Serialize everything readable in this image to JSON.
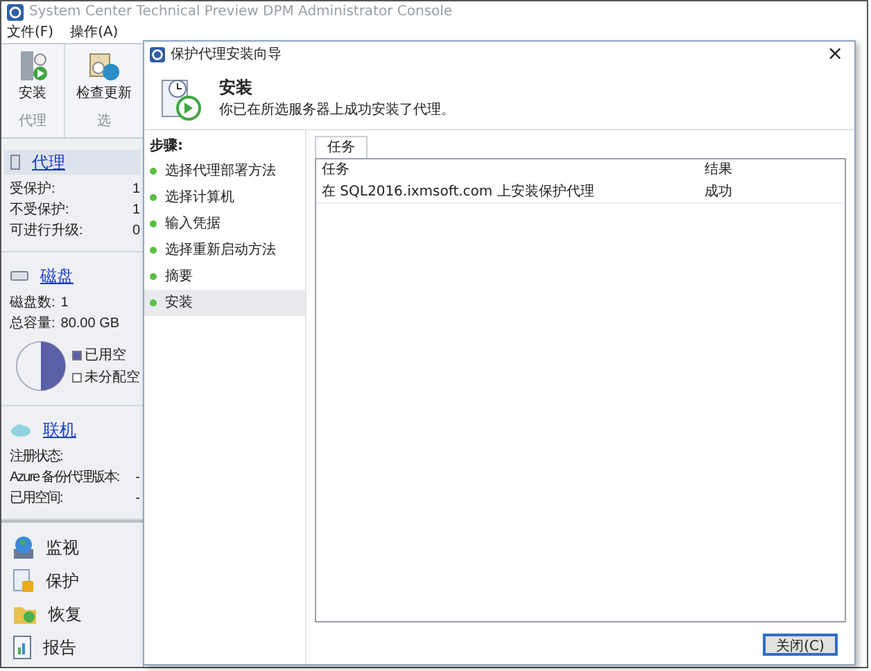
{
  "window": {
    "title": "System Center Technical Preview DPM Administrator Console"
  },
  "menu": [
    "文件(F)",
    "操作(A)"
  ],
  "ribbon": {
    "buttons": [
      {
        "label": "安装",
        "kind": "install"
      },
      {
        "label": "检查更新",
        "kind": "update"
      }
    ],
    "groups": [
      "代理",
      "选"
    ]
  },
  "sidebar": {
    "sections": [
      {
        "title": "代理",
        "kind": "agent",
        "rows": [
          {
            "label": "受保护:",
            "value": "1"
          },
          {
            "label": "不受保护:",
            "value": "1"
          },
          {
            "label": "可进行升级:",
            "value": "0"
          }
        ]
      },
      {
        "title": "磁盘",
        "kind": "disk",
        "rows": [
          {
            "label": "磁盘数:",
            "value": "1"
          },
          {
            "label": "总容量:",
            "value": "80.00 GB"
          }
        ],
        "legend": [
          {
            "label": "已用空",
            "color": "#5b5fa8"
          },
          {
            "label": "未分配空",
            "color": "#ffffff"
          }
        ]
      },
      {
        "title": "联机",
        "kind": "online",
        "rows": [
          {
            "label": "注册状态:"
          },
          {
            "label": "Azure 备份代理版本:",
            "value": "-"
          },
          {
            "label": "已用空间:",
            "value": "-"
          }
        ]
      }
    ]
  },
  "nav": [
    {
      "label": "监视",
      "kind": "monitor"
    },
    {
      "label": "保护",
      "kind": "protect"
    },
    {
      "label": "恢复",
      "kind": "recover"
    },
    {
      "label": "报告",
      "kind": "report"
    }
  ],
  "dialog": {
    "title": "保护代理安装向导",
    "close": "×",
    "heading": "安装",
    "subheading": "你已在所选服务器上成功安装了代理。",
    "steps_label": "步骤:",
    "steps": [
      {
        "label": "选择代理部署方法",
        "selected": false
      },
      {
        "label": "选择计算机",
        "selected": false
      },
      {
        "label": "输入凭据",
        "selected": false
      },
      {
        "label": "选择重新启动方法",
        "selected": false
      },
      {
        "label": "摘要",
        "selected": false
      },
      {
        "label": "安装",
        "selected": true
      }
    ],
    "tabs": [
      {
        "label": "任务",
        "selected": true
      }
    ],
    "table": {
      "columns": [
        "任务",
        "结果"
      ],
      "rows": [
        [
          "在 SQL2016.ixmsoft.com 上安装保护代理",
          "成功"
        ]
      ]
    },
    "buttons": [
      "关闭(C)"
    ]
  }
}
